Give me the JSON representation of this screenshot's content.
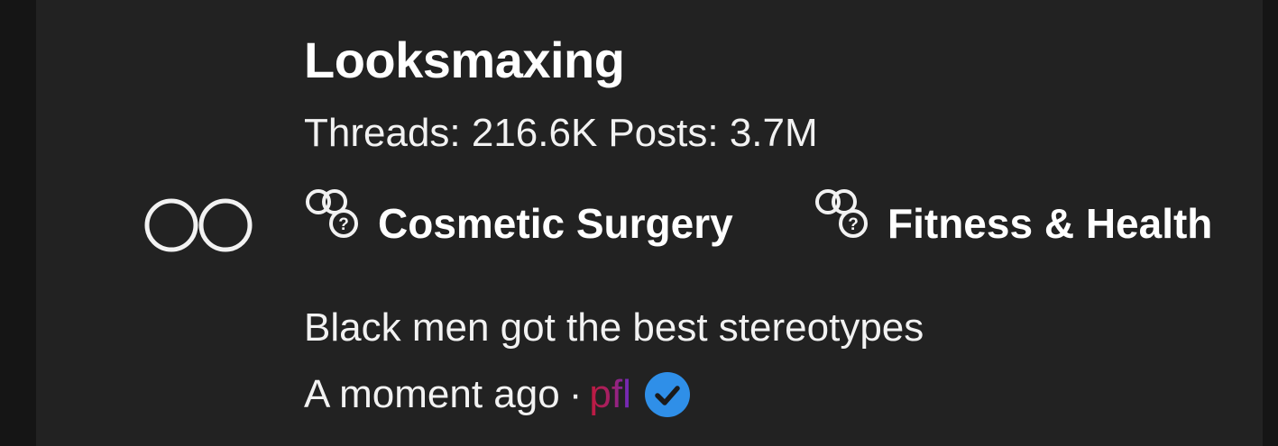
{
  "forum": {
    "title": "Looksmaxing",
    "threads_label": "Threads: 216.6K",
    "posts_label": "Posts: 3.7M",
    "icon": "infinity-rings-icon"
  },
  "tags": [
    {
      "label": "Cosmetic Surgery",
      "icon": "forum-bubble-icon"
    },
    {
      "label": "Fitness & Health",
      "icon": "forum-bubble-icon"
    }
  ],
  "latest_thread": {
    "title": "Black men got the best stereotypes",
    "time": "A moment ago",
    "separator": "·",
    "username": "pfl",
    "verified_icon": "verified-check-icon"
  },
  "colors": {
    "background": "#151515",
    "panel": "#222222",
    "text": "#ffffff",
    "username_gradient": [
      "#c21a3c",
      "#6a2cc8"
    ],
    "verified": "#2f8fe8"
  }
}
